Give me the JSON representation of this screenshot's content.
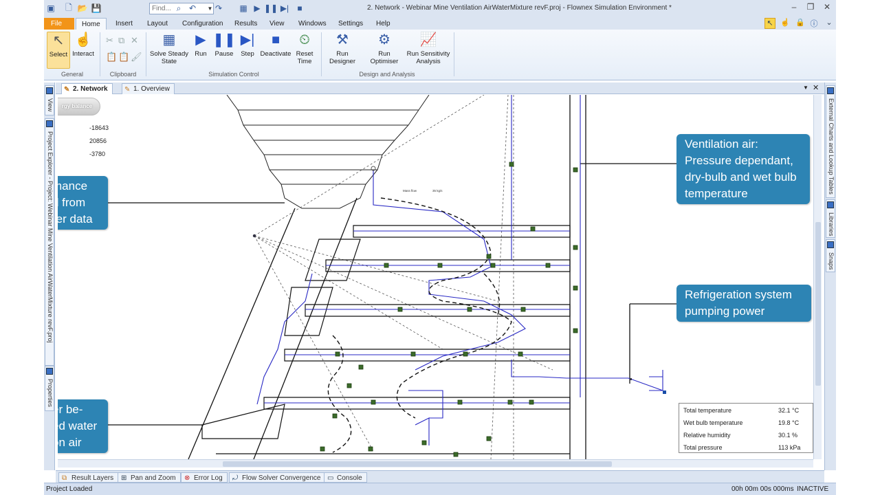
{
  "window": {
    "title": "2. Network - Webinar Mine Ventilation AirWaterMixture revF.proj - Flownex Simulation Environment *",
    "find_placeholder": "Find...",
    "controls": {
      "minimize": "–",
      "restore": "❐",
      "close": "✕"
    }
  },
  "ribbon": {
    "tabs": [
      "File",
      "Home",
      "Insert",
      "Layout",
      "Configuration",
      "Results",
      "View",
      "Windows",
      "Settings",
      "Help"
    ],
    "groups": {
      "general": "General",
      "clipboard": "Clipboard",
      "simulation": "Simulation Control",
      "design": "Design and Analysis"
    },
    "buttons": {
      "select": "Select",
      "interact": "Interact",
      "solve_steady_1": "Solve Steady",
      "solve_steady_2": "State",
      "run": "Run",
      "pause": "Pause",
      "step": "Step",
      "deactivate": "Deactivate",
      "reset_1": "Reset",
      "reset_2": "Time",
      "run_designer": "Run Designer",
      "run_optimiser": "Run Optimiser",
      "run_sens_1": "Run Sensitivity",
      "run_sens_2": "Analysis"
    }
  },
  "left_panels": {
    "view": "View",
    "project_explorer": "Project Explorer - Project: Webinar Mine Ventilation AirWaterMixture revF.proj",
    "properties": "Properties"
  },
  "right_panels": {
    "charts": "External Charts and Lookup Tables",
    "libraries": "Libraries",
    "snaps": "Snaps"
  },
  "doc_tabs": [
    "2. Network",
    "1. Overview"
  ],
  "canvas": {
    "energy_label": "rgy balance",
    "energy_values": [
      "-18643",
      "20856",
      "-3780"
    ],
    "tiny_labels": [
      "Mass flow",
      "35 kg/s"
    ],
    "callouts": {
      "left_top": [
        "mance",
        "d from",
        "rer data"
      ],
      "left_bottom": [
        "er be-",
        "ed water",
        "on air"
      ],
      "ventilation": [
        "Ventilation air:",
        "Pressure dependant,",
        "dry-bulb and wet bulb",
        "temperature"
      ],
      "refrigeration": [
        "Refrigeration system",
        "pumping power"
      ]
    },
    "info_table": [
      {
        "label": "Total temperature",
        "value": "32.1 °C"
      },
      {
        "label": "Wet bulb temperature",
        "value": "19.8 °C"
      },
      {
        "label": "Relative humidity",
        "value": "30.1 %"
      },
      {
        "label": "Total pressure",
        "value": "113 kPa"
      }
    ]
  },
  "bottom_tabs": [
    "Result Layers",
    "Pan and Zoom",
    "Error Log",
    "Flow Solver Convergence",
    "Console"
  ],
  "status": {
    "left": "Project Loaded",
    "time": "00h 00m 00s 000ms",
    "state": "INACTIVE"
  }
}
